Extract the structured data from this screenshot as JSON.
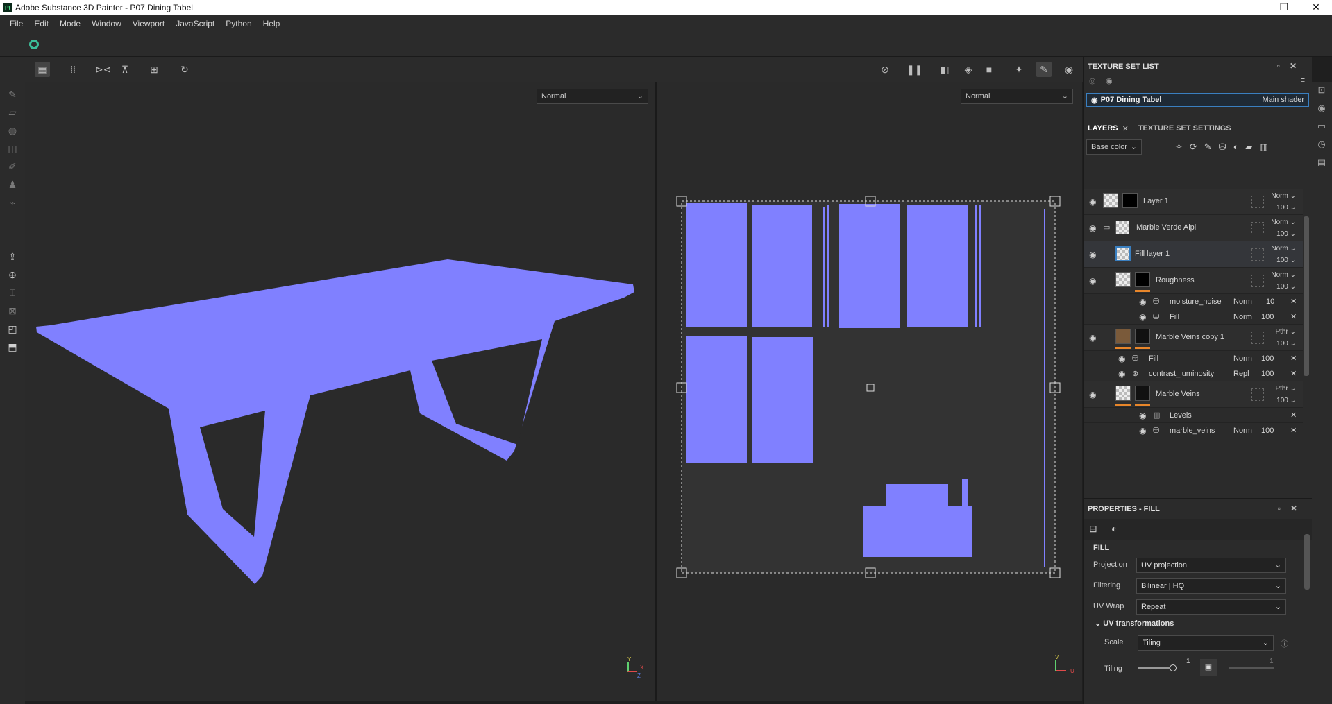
{
  "app": {
    "icon_text": "Pt",
    "title": "Adobe Substance 3D Painter - P07 Dining Tabel"
  },
  "window_controls": {
    "minimize": "—",
    "maximize": "❐",
    "close": "✕"
  },
  "menu": [
    "File",
    "Edit",
    "Mode",
    "Window",
    "Viewport",
    "JavaScript",
    "Python",
    "Help"
  ],
  "viewport3d": {
    "blend_mode": "Normal",
    "axis": {
      "y": "Y",
      "x": "X",
      "z": "Z"
    }
  },
  "viewportuv": {
    "blend_mode": "Normal",
    "axis": {
      "v": "V",
      "u": "U"
    }
  },
  "texture_set_list": {
    "title": "TEXTURE SET LIST",
    "item_name": "P07 Dining Tabel",
    "item_shader": "Main shader"
  },
  "layers_panel": {
    "tabs": [
      "LAYERS",
      "TEXTURE SET SETTINGS"
    ],
    "channel": "Base color",
    "layers": [
      {
        "name": "Layer 1",
        "blend": "Norm",
        "opacity": "100"
      },
      {
        "name": "Marble Verde Alpi",
        "blend": "Norm",
        "opacity": "100"
      },
      {
        "name": "Fill layer 1",
        "blend": "Norm",
        "opacity": "100"
      },
      {
        "name": "Roughness",
        "blend": "Norm",
        "opacity": "100"
      },
      {
        "name": "Marble Veins copy 1",
        "blend": "Pthr",
        "opacity": "100"
      },
      {
        "name": "Marble Veins",
        "blend": "Pthr",
        "opacity": "100"
      }
    ],
    "effects": [
      {
        "name": "moisture_noise",
        "blend": "Norm",
        "opacity": "10"
      },
      {
        "name": "Fill",
        "blend": "Norm",
        "opacity": "100"
      },
      {
        "name": "Fill",
        "blend": "Norm",
        "opacity": "100"
      },
      {
        "name": "contrast_luminosity",
        "blend": "Repl",
        "opacity": "100"
      },
      {
        "name": "Levels",
        "blend": "",
        "opacity": ""
      },
      {
        "name": "marble_veins",
        "blend": "Norm",
        "opacity": "100"
      }
    ]
  },
  "properties": {
    "title": "PROPERTIES - FILL",
    "section": "FILL",
    "projection_label": "Projection",
    "projection_value": "UV projection",
    "filtering_label": "Filtering",
    "filtering_value": "Bilinear | HQ",
    "uvwrap_label": "UV Wrap",
    "uvwrap_value": "Repeat",
    "uvtrans_label": "UV transformations",
    "scale_label": "Scale",
    "scale_value": "Tiling",
    "tiling_label": "Tiling",
    "tiling_value_1": "1",
    "tiling_value_2": "1"
  },
  "colors": {
    "mesh": "#8080ff",
    "accent": "#3a7fc0",
    "orange": "#e8862a"
  }
}
